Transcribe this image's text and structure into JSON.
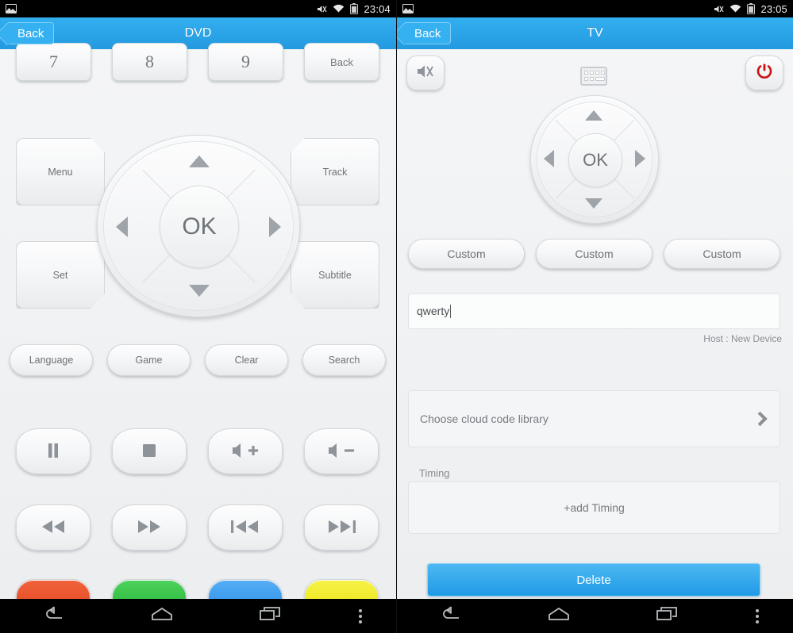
{
  "left": {
    "statusbar": {
      "time": "23:04",
      "icons": [
        "photo-icon",
        "mute-icon",
        "wifi-icon",
        "battery-icon"
      ]
    },
    "titlebar": {
      "back_label": "Back",
      "title": "DVD"
    },
    "numbers": [
      "7",
      "8",
      "9"
    ],
    "num_back_label": "Back",
    "side_buttons": {
      "menu": "Menu",
      "set": "Set",
      "track": "Track",
      "subtitle": "Subtitle"
    },
    "dpad": {
      "ok": "OK"
    },
    "func_row": [
      "Language",
      "Game",
      "Clear",
      "Search"
    ],
    "media_row": [
      "pause-icon",
      "stop-icon",
      "volume-up-icon",
      "volume-down-icon"
    ],
    "transport_row": [
      "rewind-icon",
      "fast-forward-icon",
      "previous-track-icon",
      "next-track-icon"
    ],
    "color_row": [
      {
        "name": "red-button",
        "color": "#e8482a"
      },
      {
        "name": "green-button",
        "color": "#2ebc3f"
      },
      {
        "name": "blue-button",
        "color": "#3399ee"
      },
      {
        "name": "yellow-button",
        "color": "#ece81a"
      }
    ]
  },
  "right": {
    "statusbar": {
      "time": "23:05"
    },
    "titlebar": {
      "back_label": "Back",
      "title": "TV"
    },
    "top_buttons": {
      "mute": "mute-icon",
      "keyboard": "keyboard-icon",
      "power": "power-icon"
    },
    "dpad": {
      "ok": "OK"
    },
    "custom_buttons": [
      "Custom",
      "Custom",
      "Custom"
    ],
    "code_input": {
      "value": "qwerty",
      "placeholder": ""
    },
    "host_label": "Host : New Device",
    "cloud_library_label": "Choose cloud code library",
    "timing_section_label": "Timing",
    "add_timing_label": "+add Timing",
    "delete_label": "Delete"
  },
  "navbar": {
    "items": [
      "back-nav-icon",
      "home-nav-icon",
      "recents-nav-icon",
      "overflow-menu-icon"
    ]
  },
  "colors": {
    "accent": "#2ea8ec",
    "power_red": "#cc1111",
    "background": "#f2f3f4"
  }
}
